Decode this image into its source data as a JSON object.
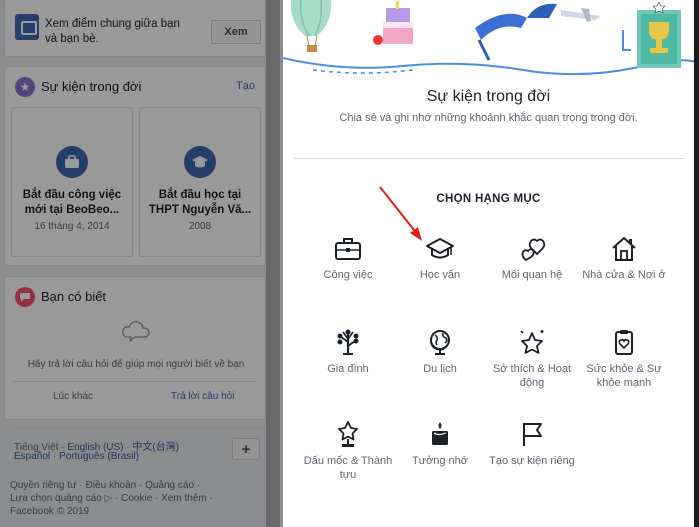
{
  "background": {
    "compare": {
      "text": "Xem điểm chung giữa bạn và bạn bè.",
      "button": "Xem"
    },
    "life_events": {
      "title": "Sự kiện trong đời",
      "create_link": "Tạo",
      "events": [
        {
          "title": "Bắt đầu công việc mới tại BeoBeo...",
          "date": "16 tháng 4, 2014",
          "icon": "briefcase-icon"
        },
        {
          "title": "Bắt đầu học tại THPT Nguyễn Vă...",
          "date": "2008",
          "icon": "graduation-cap-icon"
        }
      ]
    },
    "did_you_know": {
      "title": "Bạn có biết",
      "question": "Hãy trả lời câu hỏi để giúp mọi người biết về bạn",
      "skip": "Lúc khác",
      "answer": "Trả lời câu hỏi"
    },
    "languages": {
      "current": "Tiếng Việt",
      "links_row1": [
        "English (US)",
        "中文(台灣)"
      ],
      "links_row2": [
        "Español",
        "Português (Brasil)"
      ],
      "more_button": "+"
    },
    "footer": {
      "row1": "Quyền riêng tư · Điều khoản · Quảng cáo ·",
      "row2": "Lựa chọn quảng cáo ▷ · Cookie · Xem thêm ·",
      "row3": "Facebook © 2019"
    }
  },
  "dialog": {
    "title": "Sự kiện trong đời",
    "subtitle": "Chia sẻ và ghi nhớ những khoảnh khắc quan trọng trong đời.",
    "section_heading": "CHỌN HẠNG MỤC",
    "categories": [
      {
        "label": "Công việc",
        "icon": "briefcase-icon"
      },
      {
        "label": "Học vấn",
        "icon": "graduation-cap-icon"
      },
      {
        "label": "Mối quan hệ",
        "icon": "hearts-icon"
      },
      {
        "label": "Nhà cửa & Nơi ở",
        "icon": "house-icon"
      },
      {
        "label": "Gia đình",
        "icon": "family-tree-icon"
      },
      {
        "label": "Du lịch",
        "icon": "globe-icon"
      },
      {
        "label": "Sở thích & Hoạt động",
        "icon": "sparkle-star-icon"
      },
      {
        "label": "Sức khỏe & Sự khỏe mạnh",
        "icon": "clipboard-heart-icon"
      },
      {
        "label": "Dấu mốc & Thành tựu",
        "icon": "trophy-star-icon"
      },
      {
        "label": "Tưởng nhớ",
        "icon": "candle-icon"
      },
      {
        "label": "Tạo sự kiện riêng",
        "icon": "flag-icon"
      }
    ]
  },
  "colors": {
    "fb_blue": "#4267b2",
    "annotation_arrow": "#e0201b",
    "overlay": "rgba(0,0,0,0.4)"
  }
}
